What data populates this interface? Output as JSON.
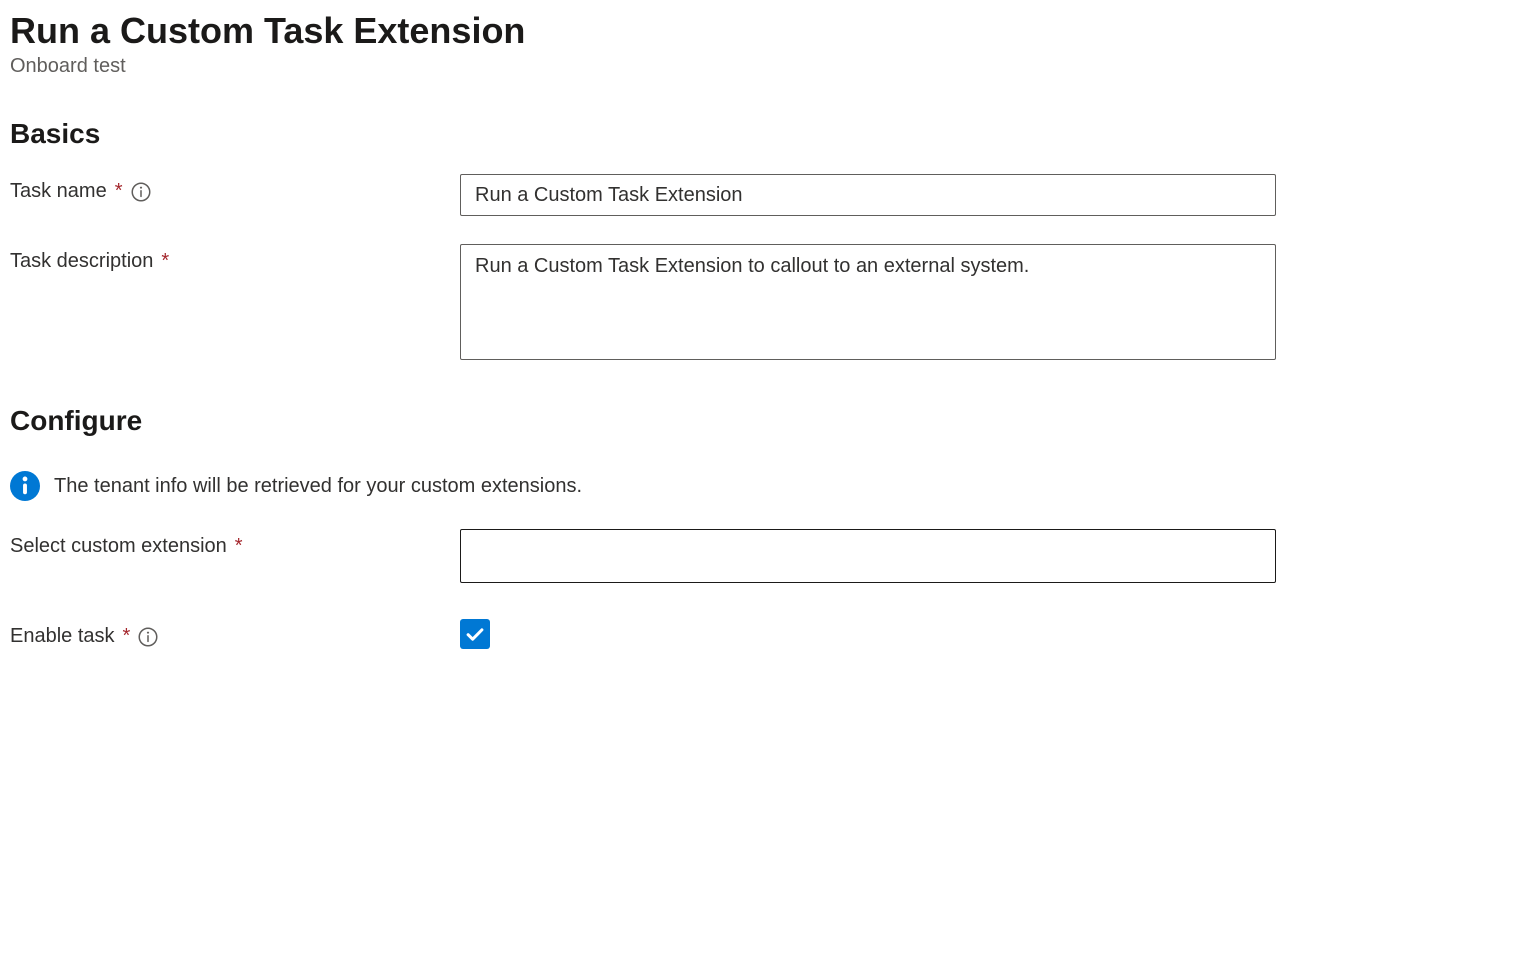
{
  "header": {
    "title": "Run a Custom Task Extension",
    "subtitle": "Onboard test"
  },
  "sections": {
    "basics": {
      "title": "Basics",
      "fields": {
        "task_name": {
          "label": "Task name",
          "value": "Run a Custom Task Extension"
        },
        "task_description": {
          "label": "Task description",
          "value": "Run a Custom Task Extension to callout to an external system."
        }
      }
    },
    "configure": {
      "title": "Configure",
      "info_text": "The tenant info will be retrieved for your custom extensions.",
      "fields": {
        "select_extension": {
          "label": "Select custom extension",
          "value": ""
        },
        "enable_task": {
          "label": "Enable task",
          "checked": true
        }
      }
    }
  }
}
